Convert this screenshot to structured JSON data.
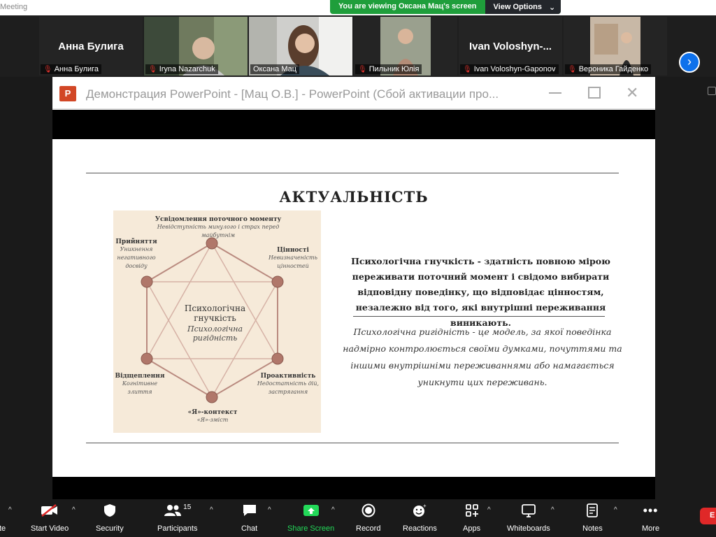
{
  "app": {
    "window_title": "Meeting"
  },
  "banner": {
    "viewing_text": "You are viewing Оксана Мац's screen",
    "view_options": "View Options"
  },
  "participants": [
    {
      "big_name": "Анна Булига",
      "label": "Анна Булига",
      "video": false
    },
    {
      "big_name": "",
      "label": "Iryna Nazarchuk",
      "video": true
    },
    {
      "big_name": "",
      "label": "Оксана Мац",
      "video": true,
      "active": true
    },
    {
      "big_name": "",
      "label": "Пильник Юлія",
      "video": true
    },
    {
      "big_name": "Ivan Voloshyn-...",
      "label": "Ivan Voloshyn-Gaponov",
      "video": false
    },
    {
      "big_name": "",
      "label": "Вероника Гайденко",
      "video": true
    }
  ],
  "ppt": {
    "caption": "Демонстрация PowerPoint - [Мац О.В.] - PowerPoint (Сбой активации про...",
    "logo": "P"
  },
  "slide": {
    "title": "АКТУАЛЬНІСТЬ",
    "diagram": {
      "center_title": "Психологічна гнучкість",
      "center_sub": "Психологічна ригідність",
      "nodes": [
        {
          "title": "Усвідомлення поточного моменту",
          "sub": "Невідступність минулого і страх перед майбутнім"
        },
        {
          "title": "Цінності",
          "sub": "Невизначеність цінностей"
        },
        {
          "title": "Проактивність",
          "sub": "Недостатність дій, застрягання"
        },
        {
          "title": "«Я»-контекст",
          "sub": "«Я»-зміст"
        },
        {
          "title": "Відщеплення",
          "sub": "Когнітивне злиття"
        },
        {
          "title": "Прийняття",
          "sub": "Уникнення негативного досвіду"
        }
      ]
    },
    "paragraph_bold": "Психологічна гнучкість - здатність повною мірою переживати поточний момент і свідомо вибирати відповідну поведінку, що відповідає цінностям, незалежно від того, які внутрішні переживання виникають.",
    "paragraph_italic": "Психологічна ригідність - це модель, за якої поведінка надмірно контролюється своїми думками, почуттями та іншими внутрішніми переживаннями або намагається уникнути цих переживань."
  },
  "toolbar": {
    "audio_cut": "te",
    "start_video": "Start Video",
    "security": "Security",
    "participants": "Participants",
    "participants_count": "15",
    "chat": "Chat",
    "share_screen": "Share Screen",
    "record": "Record",
    "reactions": "Reactions",
    "apps": "Apps",
    "whiteboards": "Whiteboards",
    "notes": "Notes",
    "more": "More",
    "end": "E"
  },
  "colors": {
    "share_green": "#23d959",
    "banner_green": "#1f9e3b",
    "ppt_red": "#d24726",
    "node_color": "#b0776a",
    "zoom_blue": "#0e71eb"
  }
}
